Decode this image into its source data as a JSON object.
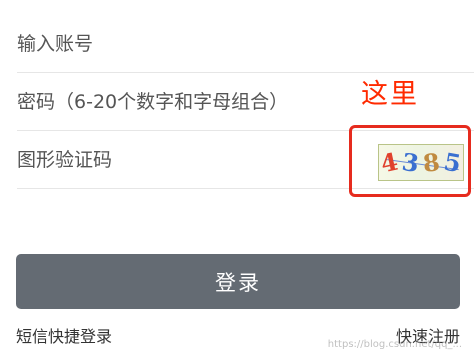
{
  "form": {
    "account_placeholder": "输入账号",
    "password_placeholder": "密码（6-20个数字和字母组合）",
    "captcha_placeholder": "图形验证码"
  },
  "annotation": {
    "text": "这里",
    "color": "#ff2a00"
  },
  "captcha": {
    "chars": [
      {
        "char": "4",
        "color": "#e0412d"
      },
      {
        "char": "3",
        "color": "#3a6fd0"
      },
      {
        "char": "8",
        "color": "#c08a40"
      },
      {
        "char": "5",
        "color": "#3a6fd0"
      }
    ]
  },
  "buttons": {
    "login_label": "登录",
    "login_color": "#646b73"
  },
  "links": {
    "sms_login": "短信快捷登录",
    "quick_register": "快速注册"
  },
  "watermark": "https://blog.csdn.net/qq_..."
}
